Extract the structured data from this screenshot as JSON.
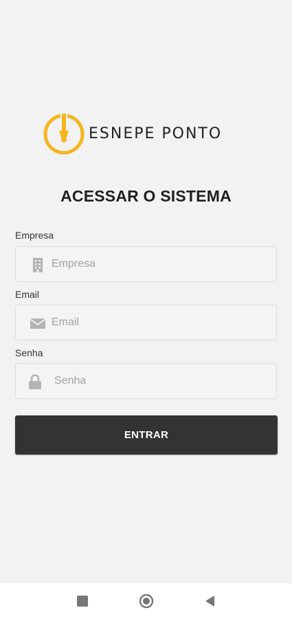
{
  "brand": {
    "name": "ESNEPE PONTO",
    "accent_color": "#f5b51f"
  },
  "login": {
    "title": "ACESSAR O SISTEMA",
    "fields": [
      {
        "label": "Empresa",
        "placeholder": "Empresa",
        "value": "",
        "icon": "building-icon"
      },
      {
        "label": "Email",
        "placeholder": "Email",
        "value": "",
        "icon": "envelope-icon"
      },
      {
        "label": "Senha",
        "placeholder": "Senha",
        "value": "",
        "icon": "lock-icon"
      }
    ],
    "submit_label": "ENTRAR",
    "submit_color": "#333333"
  },
  "system_nav": {
    "recents_icon": "square-icon",
    "home_icon": "circle-home-icon",
    "back_icon": "triangle-back-icon"
  }
}
